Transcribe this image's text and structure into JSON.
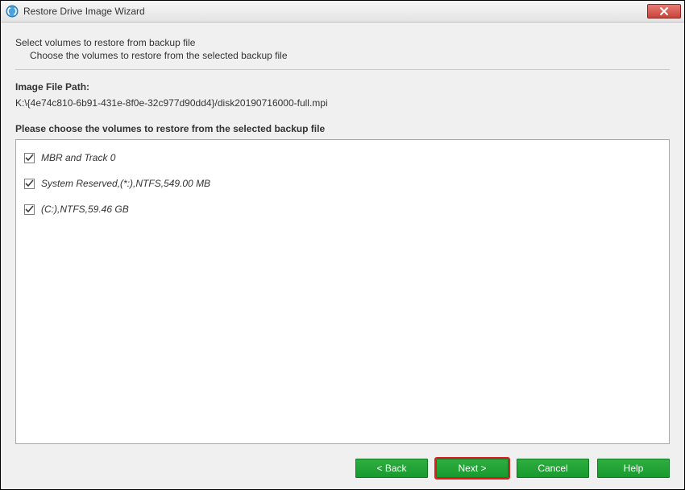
{
  "window": {
    "title": "Restore Drive Image Wizard"
  },
  "intro": {
    "title": "Select volumes to restore from backup file",
    "subtitle": "Choose the volumes to restore from the selected backup file"
  },
  "image_path": {
    "label": "Image File Path:",
    "value": "K:\\{4e74c810-6b91-431e-8f0e-32c977d90dd4}/disk20190716000-full.mpi"
  },
  "volumes": {
    "label": "Please choose the volumes to restore from the selected backup file",
    "items": [
      {
        "checked": true,
        "label": "MBR and Track 0"
      },
      {
        "checked": true,
        "label": "System Reserved,(*:),NTFS,549.00 MB"
      },
      {
        "checked": true,
        "label": "(C:),NTFS,59.46 GB"
      }
    ]
  },
  "buttons": {
    "back": "< Back",
    "next": "Next >",
    "cancel": "Cancel",
    "help": "Help"
  }
}
